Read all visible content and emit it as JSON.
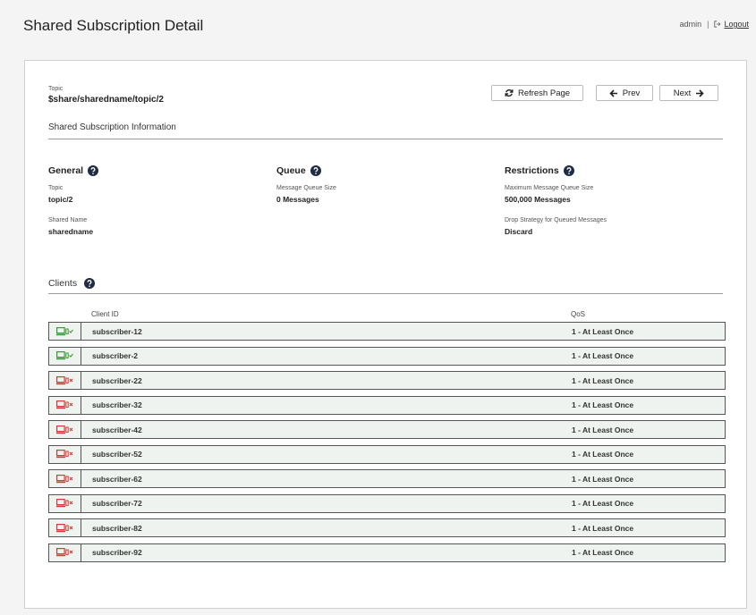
{
  "header": {
    "title": "Shared Subscription Detail",
    "user": "admin",
    "separator": "|",
    "logout_label": "Logout"
  },
  "topic": {
    "label": "Topic",
    "value": "$share/sharedname/topic/2"
  },
  "buttons": {
    "refresh": "Refresh Page",
    "prev": "Prev",
    "next": "Next"
  },
  "section_title": "Shared Subscription Information",
  "general": {
    "title": "General",
    "topic_label": "Topic",
    "topic_value": "topic/2",
    "shared_name_label": "Shared Name",
    "shared_name_value": "sharedname"
  },
  "queue": {
    "title": "Queue",
    "size_label": "Message Queue Size",
    "size_value": "0 Messages"
  },
  "restrictions": {
    "title": "Restrictions",
    "max_label": "Maximum Message Queue Size",
    "max_value": "500,000 Messages",
    "drop_label": "Drop Strategy for Queued Messages",
    "drop_value": "Discard"
  },
  "clients": {
    "title": "Clients",
    "columns": {
      "client_id": "Client ID",
      "qos": "QoS"
    },
    "rows": [
      {
        "client_id": "subscriber-12",
        "qos": "1 - At Least Once",
        "connected": true
      },
      {
        "client_id": "subscriber-2",
        "qos": "1 - At Least Once",
        "connected": true
      },
      {
        "client_id": "subscriber-22",
        "qos": "1 - At Least Once",
        "connected": false
      },
      {
        "client_id": "subscriber-32",
        "qos": "1 - At Least Once",
        "connected": false
      },
      {
        "client_id": "subscriber-42",
        "qos": "1 - At Least Once",
        "connected": false
      },
      {
        "client_id": "subscriber-52",
        "qos": "1 - At Least Once",
        "connected": false
      },
      {
        "client_id": "subscriber-62",
        "qos": "1 - At Least Once",
        "connected": false
      },
      {
        "client_id": "subscriber-72",
        "qos": "1 - At Least Once",
        "connected": false
      },
      {
        "client_id": "subscriber-82",
        "qos": "1 - At Least Once",
        "connected": false
      },
      {
        "client_id": "subscriber-92",
        "qos": "1 - At Least Once",
        "connected": false
      }
    ]
  },
  "colors": {
    "connected": "#3a9a3a",
    "disconnected": "#d33a3a",
    "help_icon": "#1f2a44",
    "row_bg": "#eef3ef"
  },
  "icons": {
    "refresh": "refresh-icon",
    "prev": "arrow-left-icon",
    "next": "arrow-right-icon",
    "help": "question-circle-icon",
    "logout": "sign-out-icon",
    "client_connected": "client-connected-icon",
    "client_disconnected": "client-disconnected-icon"
  }
}
